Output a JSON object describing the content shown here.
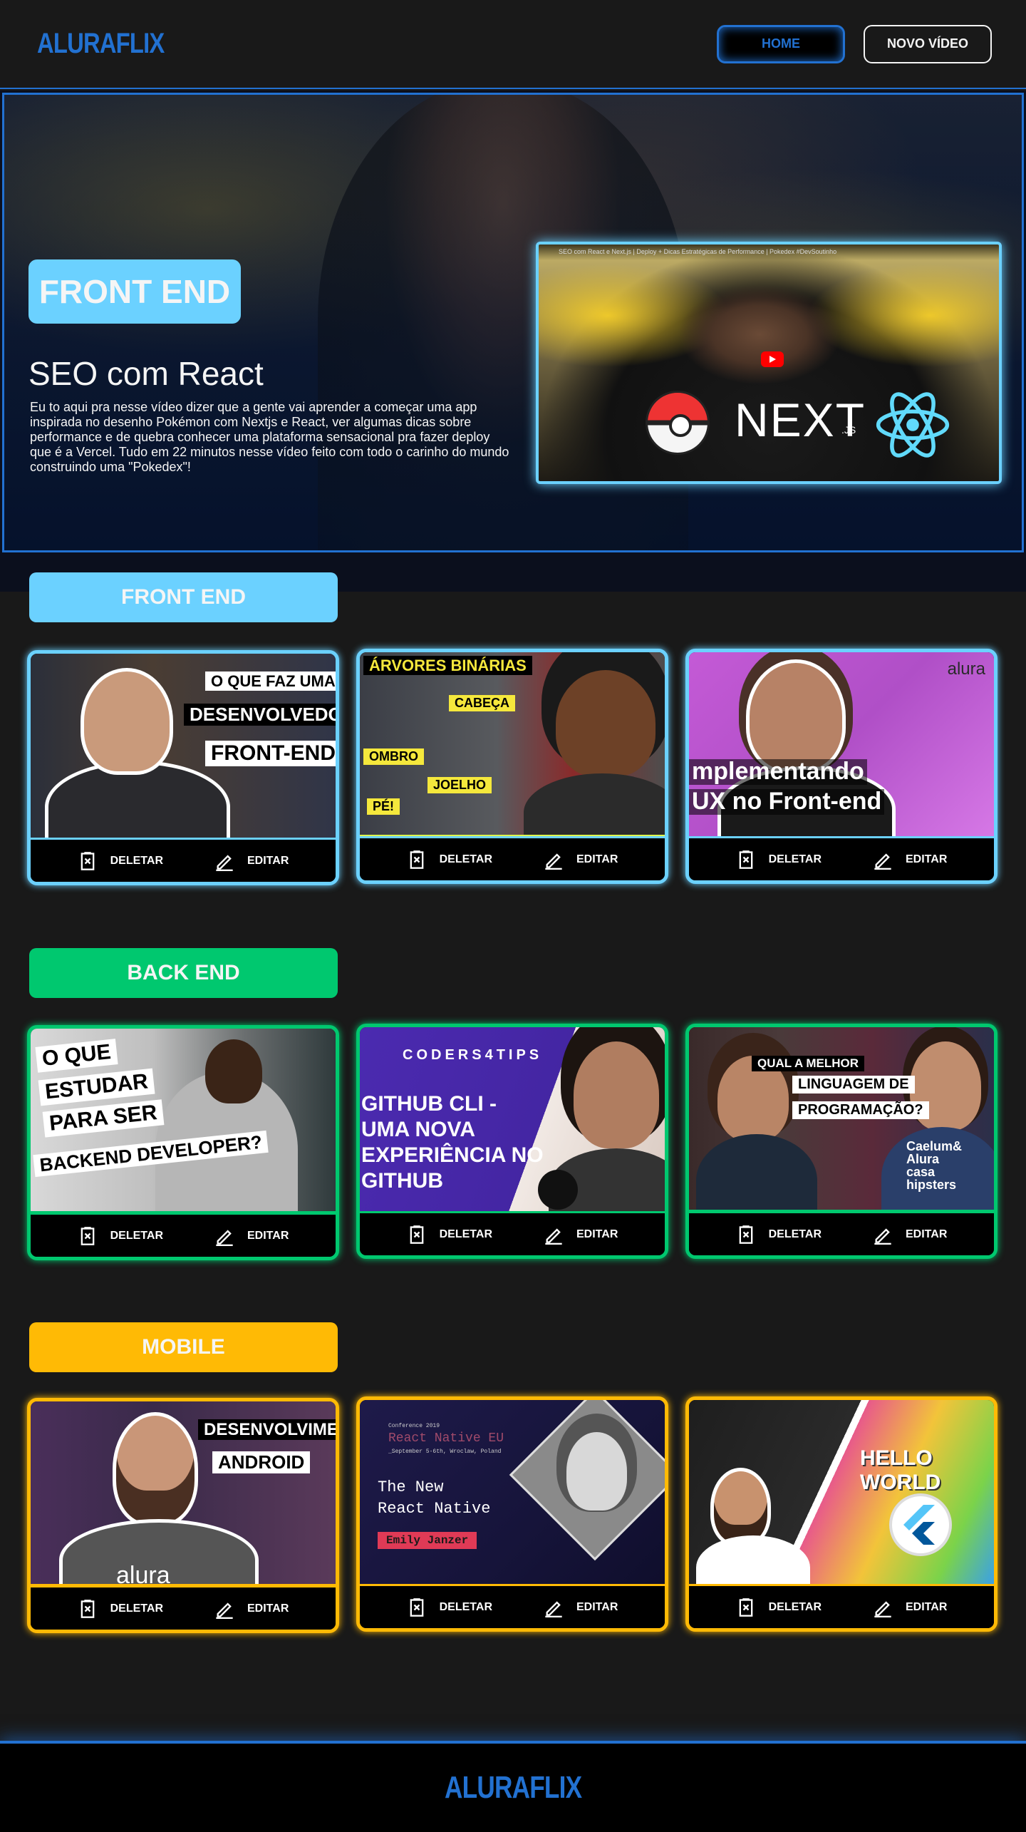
{
  "header": {
    "logo": "ALURAFLIX",
    "nav": {
      "home_label": "HOME",
      "new_video_label": "NOVO VÍDEO"
    }
  },
  "banner": {
    "tag": "FRONT END",
    "title": "SEO com React",
    "description": "Eu to aqui pra nesse vídeo dizer que a gente vai aprender a começar uma app inspirada no desenho Pokémon com Nextjs e React, ver algumas dicas sobre performance e de quebra conhecer uma plataforma sensacional pra fazer deploy que é a Vercel. Tudo em 22 minutos nesse vídeo feito com todo o carinho do mundo construindo uma \"Pokedex\"!",
    "player_title": "SEO com React e Next.js | Deploy + Dicas Estratégicas de Performance | Pokedex #DevSoutinho",
    "player_logo": "NEXT",
    "player_logo_suffix": ".JS"
  },
  "colors": {
    "accent": "#2271D1",
    "front_end": "#6BD1FF",
    "back_end": "#00C86F",
    "mobile": "#FFBA05"
  },
  "actions": {
    "delete_label": "DELETAR",
    "edit_label": "EDITAR",
    "delete_icon": "trash-icon",
    "edit_icon": "pencil-icon"
  },
  "categories": [
    {
      "name": "FRONT END",
      "videos": [
        {
          "thumb_lines": [
            "O QUE FAZ UMA",
            "DESENVOLVEDORA",
            "FRONT-END"
          ]
        },
        {
          "thumb_lines": [
            "ÁRVORES BINÁRIAS",
            "CABEÇA",
            "OMBRO",
            "JOELHO",
            "PÉ!"
          ]
        },
        {
          "thumb_lines": [
            "alura",
            "mplementando",
            "UX no Front-end"
          ]
        }
      ]
    },
    {
      "name": "BACK END",
      "videos": [
        {
          "thumb_lines": [
            "O QUE",
            "ESTUDAR",
            "PARA SER",
            "BACKEND DEVELOPER?"
          ]
        },
        {
          "thumb_lines": [
            "CODERS4TIPS",
            "GITHUB CLI -",
            "UMA NOVA",
            "EXPERIÊNCIA NO",
            "GITHUB"
          ]
        },
        {
          "thumb_lines": [
            "QUAL A MELHOR",
            "LINGUAGEM DE",
            "PROGRAMAÇÃO?",
            "Caelum&",
            "Alura",
            "casa",
            "hipsters"
          ]
        }
      ]
    },
    {
      "name": "MOBILE",
      "videos": [
        {
          "thumb_lines": [
            "DESENVOLVIMENTO",
            "ANDROID",
            "alura"
          ]
        },
        {
          "thumb_lines": [
            "Conference 2019",
            "React Native EU",
            "_September 5-6th, Wroclaw, Poland",
            "The New",
            "React Native",
            "Emily Janzer"
          ]
        },
        {
          "thumb_lines": [
            "HELLO WORLD"
          ]
        }
      ]
    }
  ],
  "footer": {
    "logo": "ALURAFLIX"
  }
}
